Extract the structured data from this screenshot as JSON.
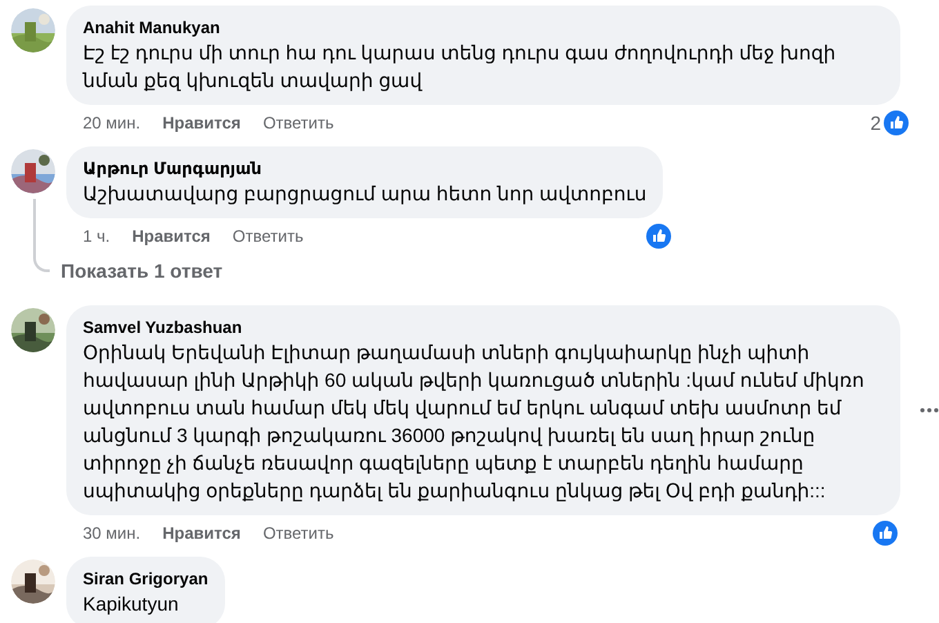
{
  "comments": [
    {
      "author": "Anahit Manukyan",
      "text": "Էշ էշ դուրս մի տուր հա դու կարաս տենց դուրս գաս ժողովուրդի մեջ խոզի նման քեզ կխուզեն տավարի ցավ",
      "time": "20 мин.",
      "like": "Нравится",
      "reply": "Ответить",
      "reaction_count": "2",
      "like_badge": true
    },
    {
      "author": "Արթուր Մարգարյան",
      "text": "Աշխատավարց բարցրացում արա հետո նոր ավտոբուս",
      "time": "1 ч.",
      "like": "Нравится",
      "reply": "Ответить",
      "like_badge": true,
      "replies_link": "Показать 1 ответ"
    },
    {
      "author": "Samvel Yuzbashuan",
      "text": "Օրինակ Երեվանի Էլիտար թաղամասի տների գույկաիարկը ինչի պիտի հավասար լինի Արթիկի 60 ական թվերի կառուցած տներին :կամ ունեմ միկռո ավտոբուս տան համար մեկ մեկ վարում եմ երկու անգամ տեխ ասմոտր եմ անցնում 3 կարգի թոշակառու 36000 թոշակով խառել են սաղ իրար շունը տիրոջը չի ճանչե ռեսավոր գազելները պետք է տարբեն դեղին համարը սպիտակից օրեքները դարձել են քարիանգուս ընկաց թել Օվ բդի քանդի:::",
      "time": "30 мин.",
      "like": "Нравится",
      "reply": "Ответить",
      "like_badge": true,
      "more_menu": true
    },
    {
      "author": "Siran Grigoryan",
      "text": "Kapikutyun"
    }
  ]
}
